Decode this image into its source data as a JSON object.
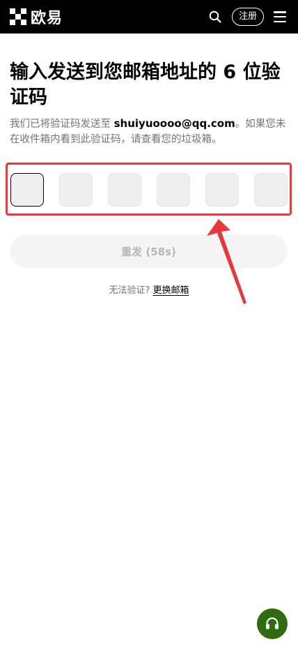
{
  "header": {
    "logo_text": "欧易",
    "register_label": "注册"
  },
  "icons": {
    "logo": "okx-logo-icon",
    "search": "search-icon",
    "menu": "hamburger-menu-icon",
    "support": "headset-support-icon"
  },
  "main": {
    "title": "输入发送到您邮箱地址的 6 位验证码",
    "desc_prefix": "我们已将验证码发送至 ",
    "email": "shuiyuoooo@qq.com",
    "desc_suffix": "。如果您未在收件箱内看到此验证码，请查看您的垃圾箱。",
    "otp_digits": [
      "",
      "",
      "",
      "",
      "",
      ""
    ],
    "resend_label": "重发 (58s)",
    "alt_prompt": "无法验证?",
    "alt_link": "更换邮箱"
  },
  "colors": {
    "header_bg": "#000000",
    "annotation": "#e8383d",
    "support_bg": "#2f6b0f"
  }
}
